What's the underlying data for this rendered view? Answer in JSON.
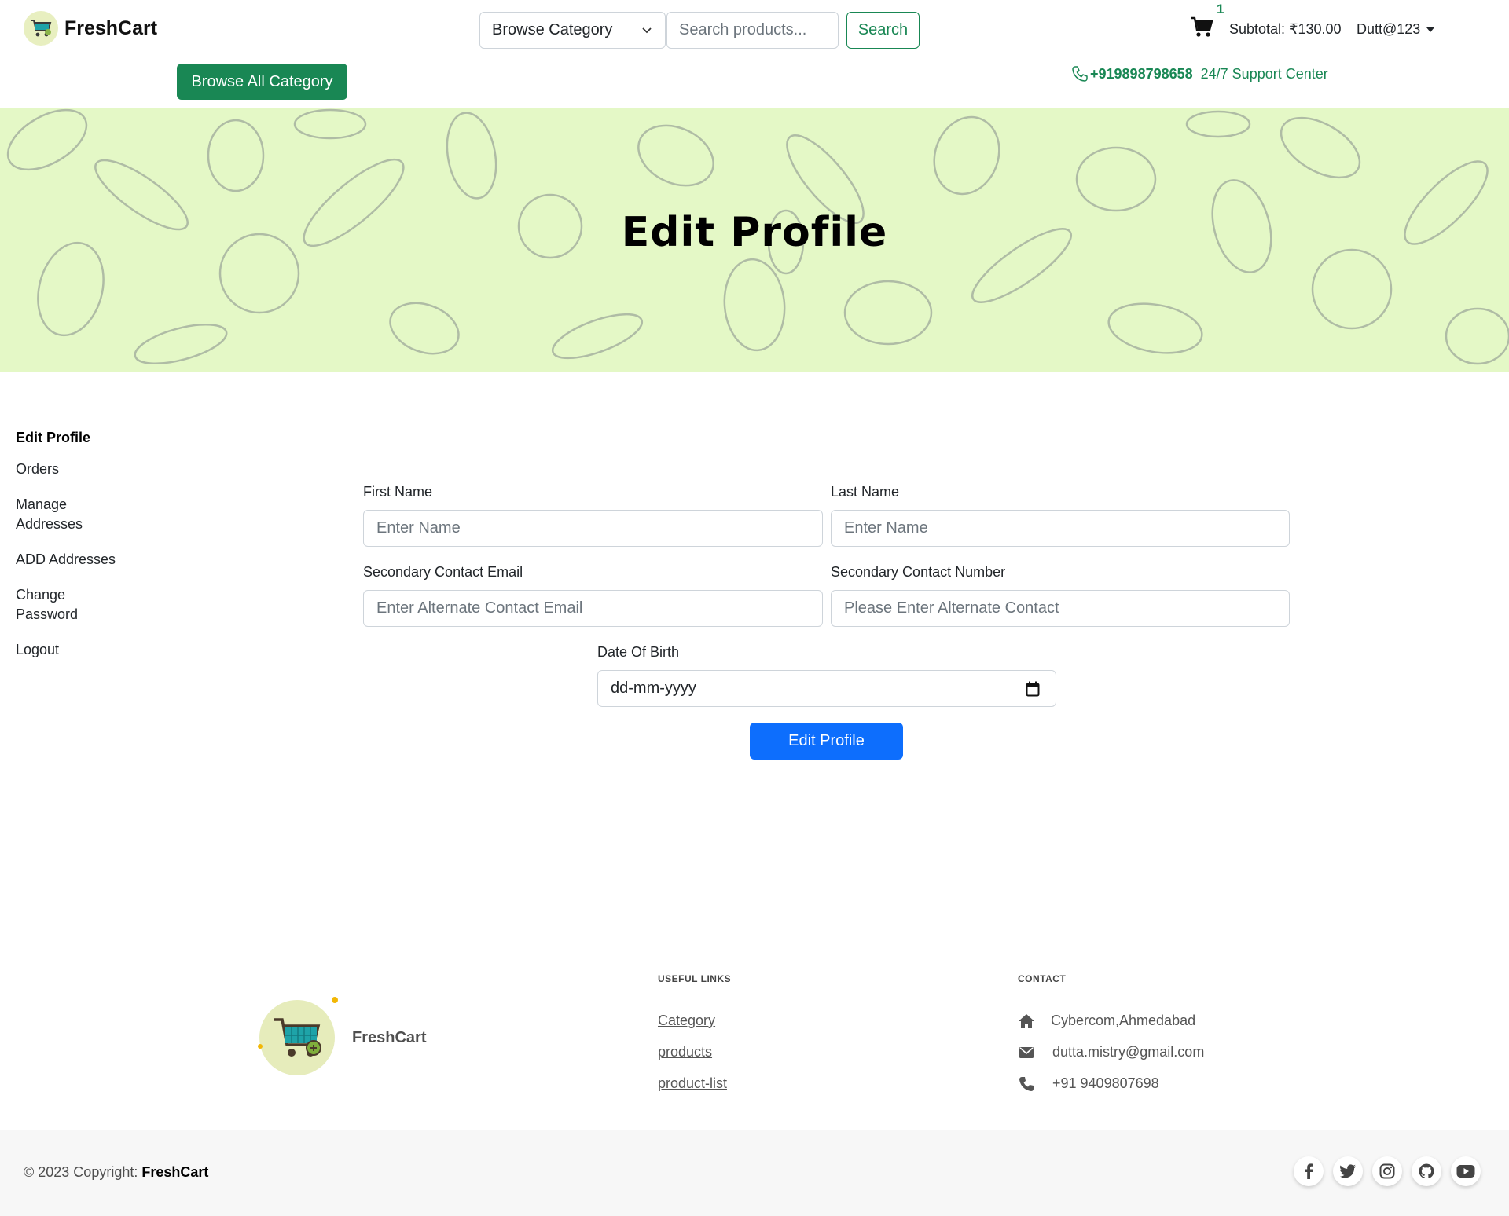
{
  "header": {
    "logo_text": "FreshCart",
    "category_select": "Browse Category",
    "search_placeholder": "Search products...",
    "search_button": "Search",
    "cart_count": "1",
    "subtotal": "Subtotal: ₹130.00",
    "user": "Dutt@123",
    "browse_all_button": "Browse All Category",
    "support_phone": "+919898798658",
    "support_label": "24/7 Support Center"
  },
  "banner": {
    "title": "Edit Profile"
  },
  "sidebar": {
    "items": [
      {
        "label": "Edit Profile",
        "active": true
      },
      {
        "label": "Orders"
      },
      {
        "label": "Manage Addresses"
      },
      {
        "label": "ADD Addresses"
      },
      {
        "label": "Change Password"
      },
      {
        "label": "Logout"
      }
    ]
  },
  "form": {
    "first_name_label": "First Name",
    "first_name_placeholder": "Enter Name",
    "last_name_label": "Last Name",
    "last_name_placeholder": "Enter Name",
    "secondary_email_label": "Secondary Contact Email",
    "secondary_email_placeholder": "Enter Alternate Contact Email",
    "secondary_number_label": "Secondary Contact Number",
    "secondary_number_placeholder": "Please Enter Alternate Contact",
    "dob_label": "Date Of Birth",
    "dob_value": "dd-mm-yyyy",
    "submit_button": "Edit Profile"
  },
  "footer": {
    "logo_text": "FreshCart",
    "useful_links_heading": "USEFUL LINKS",
    "links": [
      "Category",
      "products",
      "product-list"
    ],
    "contact_heading": "CONTACT",
    "address": "Cybercom,Ahmedabad",
    "email": "dutta.mistry@gmail.com",
    "phone": "+91 9409807698",
    "copyright_prefix": "© 2023 Copyright:",
    "copyright_brand": "FreshCart"
  },
  "colors": {
    "brand_green": "#198754",
    "primary_blue": "#0d6efd",
    "banner_bg": "#e4f8c6"
  }
}
